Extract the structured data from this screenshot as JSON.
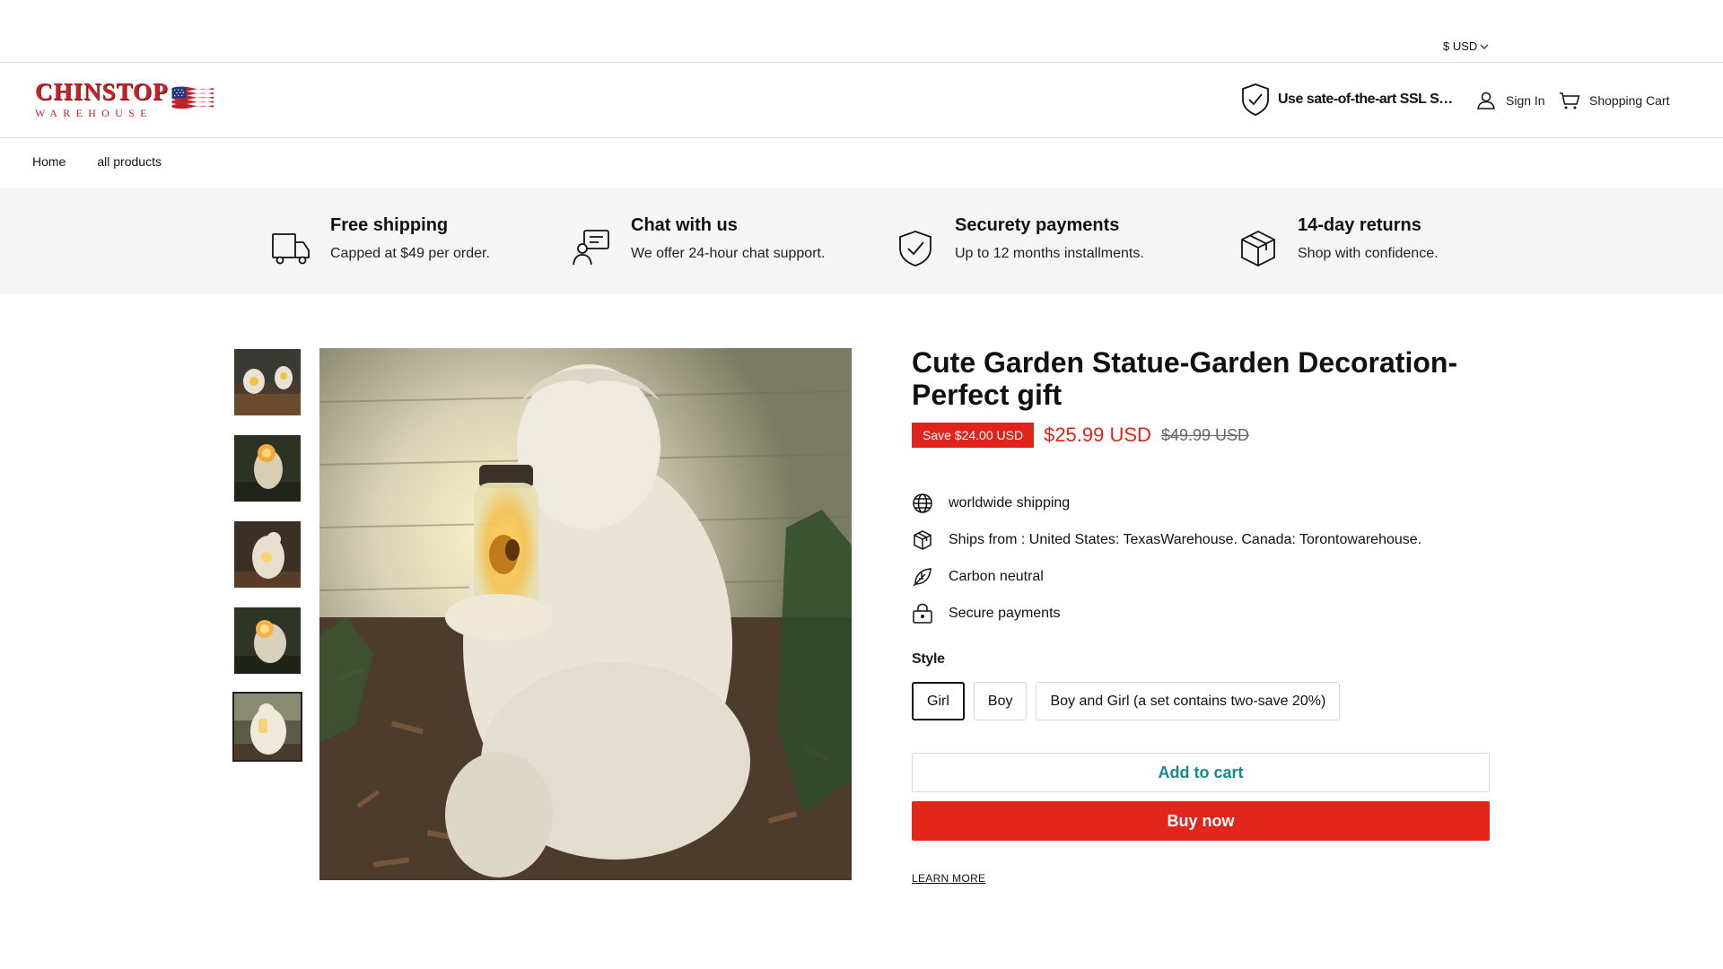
{
  "topbar": {
    "currency": "$ USD"
  },
  "header": {
    "logo_main": "CHINSTOP",
    "logo_sub": "WAREHOUSE",
    "ssl_text": "Use sate-of-the-art SSL Secure encryption to protect your data",
    "signin": "Sign In",
    "cart": "Shopping Cart"
  },
  "nav": [
    "Home",
    "all products"
  ],
  "features": [
    {
      "icon": "truck-icon",
      "title": "Free shipping",
      "text": "Capped at $49 per order."
    },
    {
      "icon": "chat-support-icon",
      "title": "Chat with us",
      "text": "We offer 24-hour chat support."
    },
    {
      "icon": "shield-check-icon",
      "title": "Securety payments",
      "text": "Up to 12 months installments."
    },
    {
      "icon": "box-icon",
      "title": "14-day returns",
      "text": "Shop with confidence."
    }
  ],
  "gallery": {
    "thumbnail_count": 5,
    "active_index": 4
  },
  "product": {
    "title": "Cute Garden Statue-Garden Decoration-Perfect gift",
    "save_badge": "Save $24.00 USD",
    "price": "$25.99 USD",
    "compare_price": "$49.99 USD",
    "info": [
      {
        "icon": "globe-icon",
        "text": "worldwide shipping"
      },
      {
        "icon": "box-icon",
        "text": "Ships from : United States: TexasWarehouse. Canada: Torontowarehouse."
      },
      {
        "icon": "leaf-icon",
        "text": "Carbon neutral"
      },
      {
        "icon": "lock-icon",
        "text": "Secure payments"
      }
    ],
    "style_label": "Style",
    "variants": [
      "Girl",
      "Boy",
      "Boy and Girl (a set contains two-save 20%)"
    ],
    "selected_variant": "Girl",
    "add_to_cart": "Add to cart",
    "buy_now": "Buy now",
    "learn_more": "LEARN MORE"
  },
  "colors": {
    "accent_red": "#e3261b",
    "add_cart_teal": "#148a8a",
    "feature_bg": "#f5f5f5"
  }
}
